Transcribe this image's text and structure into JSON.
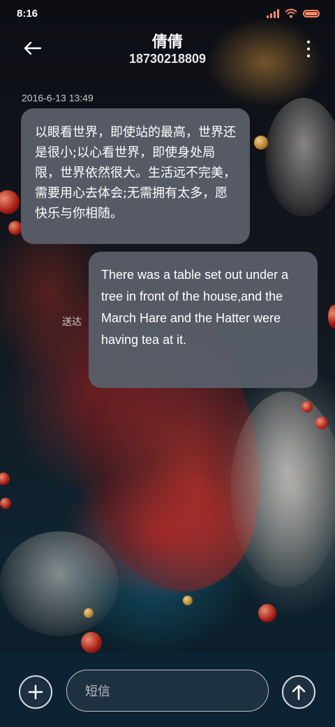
{
  "status_bar": {
    "time": "8:16",
    "icons": [
      "signal-icon",
      "wifi-icon",
      "battery-icon"
    ],
    "accent_color": "#ff8a66"
  },
  "header": {
    "contact_name": "倩倩",
    "contact_number": "18730218809",
    "back_icon": "arrow-left-icon",
    "more_icon": "more-vertical-icon"
  },
  "conversation": {
    "timestamp": "2016-6-13 13:49",
    "messages": [
      {
        "direction": "received",
        "text": "以眼看世界，即使站的最高，世界还是很小;以心看世界，即使身处局限，世界依然很大。生活远不完美，需要用心去体会;无需拥有太多，愿快乐与你相随。"
      },
      {
        "direction": "sent",
        "text": "There was a table set out under a tree in front of the house,and the March Hare and the Hatter were having tea at it.",
        "status": "送达"
      }
    ]
  },
  "composer": {
    "placeholder": "短信",
    "add_icon": "plus-icon",
    "send_icon": "arrow-up-icon"
  }
}
